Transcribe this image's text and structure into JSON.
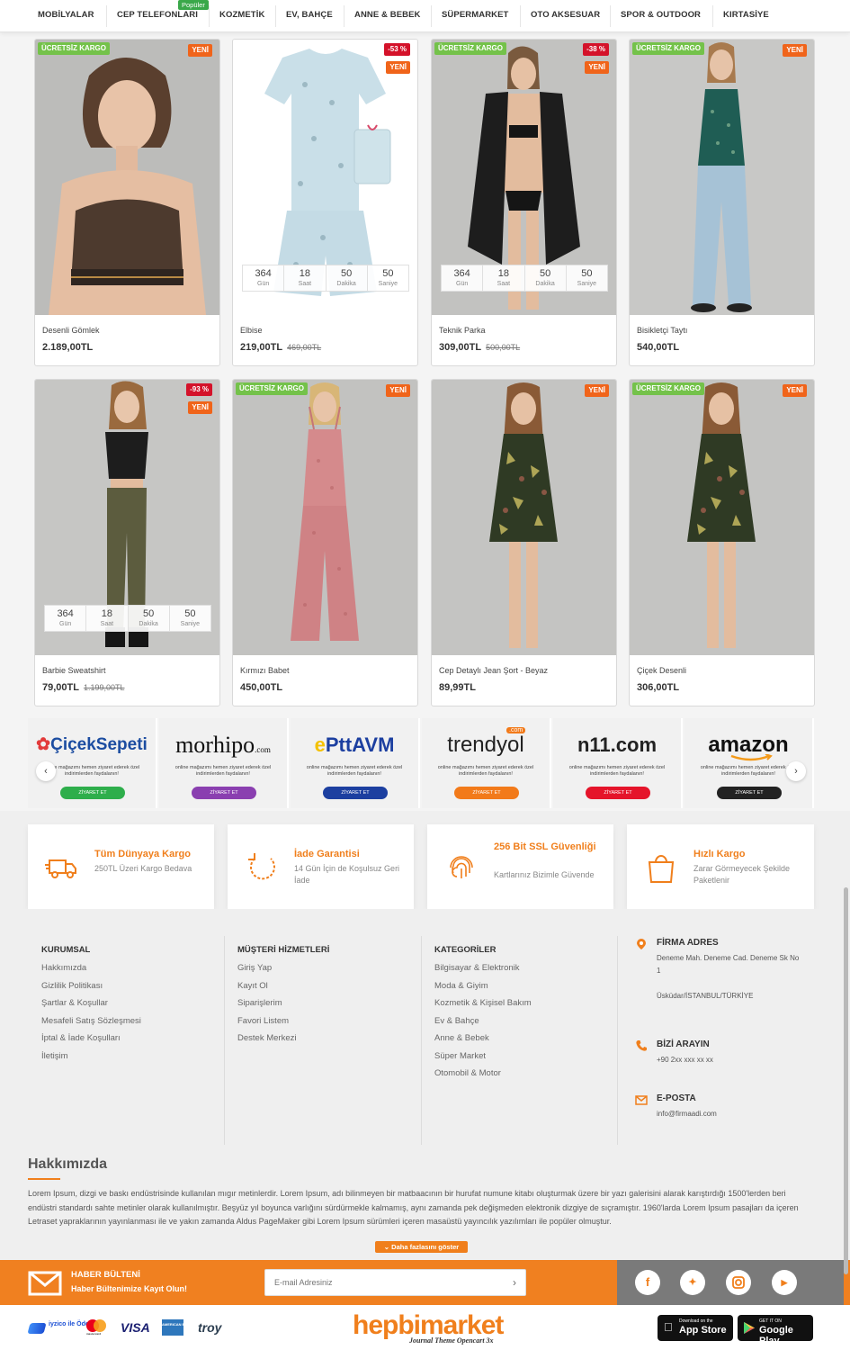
{
  "topnav": {
    "items": [
      "MOBİLYALAR",
      "CEP TELEFONLARI",
      "KOZMETİK",
      "EV, BAHÇE",
      "ANNE & BEBEK",
      "SÜPERMARKET",
      "OTO AKSESUAR",
      "SPOR & OUTDOOR",
      "KIRTASİYE"
    ],
    "popular_badge": "Popüler"
  },
  "labels": {
    "cargo": "ÜCRETSİZ KARGO",
    "new": "YENİ",
    "days": "Gün",
    "hours": "Saat",
    "minutes": "Dakika",
    "seconds": "Saniye"
  },
  "products": [
    {
      "name": "Desenli Gömlek",
      "price": "2.189,00TL",
      "old_price": "",
      "cargo": true,
      "new": true,
      "discount": "",
      "countdown": null
    },
    {
      "name": "Elbise",
      "price": "219,00TL",
      "old_price": "469,00TL",
      "cargo": false,
      "new": true,
      "discount": "-53 %",
      "countdown": [
        "364",
        "18",
        "50",
        "50"
      ]
    },
    {
      "name": "Teknik Parka",
      "price": "309,00TL",
      "old_price": "500,00TL",
      "cargo": true,
      "new": true,
      "discount": "-38 %",
      "countdown": [
        "364",
        "18",
        "50",
        "50"
      ]
    },
    {
      "name": "Bisikletçi Taytı",
      "price": "540,00TL",
      "old_price": "",
      "cargo": true,
      "new": true,
      "discount": "",
      "countdown": null
    },
    {
      "name": "Barbie Sweatshirt",
      "price": "79,00TL",
      "old_price": "1.199,00TL",
      "cargo": false,
      "new": true,
      "discount": "-93 %",
      "countdown": [
        "364",
        "18",
        "50",
        "50"
      ]
    },
    {
      "name": "Kırmızı Babet",
      "price": "450,00TL",
      "old_price": "",
      "cargo": true,
      "new": true,
      "discount": "",
      "countdown": null
    },
    {
      "name": "Cep Detaylı Jean Şort - Beyaz",
      "price": "89,99TL",
      "old_price": "",
      "cargo": false,
      "new": true,
      "discount": "",
      "countdown": null
    },
    {
      "name": "Çiçek Desenli",
      "price": "306,00TL",
      "old_price": "",
      "cargo": true,
      "new": true,
      "discount": "",
      "countdown": null
    }
  ],
  "brands": {
    "text": "online mağazımı hemen ziyaret ederek özel indirimlerden faydalanın!",
    "visit_label": "ZİYARET ET",
    "items": [
      {
        "name": "ÇiçekSepeti",
        "button_color": "#2eae4b"
      },
      {
        "name": "morhipo",
        "sub": ".com",
        "button_color": "#8a3fb0"
      },
      {
        "name": "PttAVM",
        "button_color": "#1c3fa0"
      },
      {
        "name": "trendyol",
        "badge": ".com",
        "button_color": "#f27a1a"
      },
      {
        "name": "n11.com",
        "button_color": "#e5142a"
      },
      {
        "name": "amazon",
        "button_color": "#222222"
      }
    ]
  },
  "features": [
    {
      "title": "Tüm Dünyaya Kargo",
      "subtitle": "250TL Üzeri Kargo Bedava",
      "icon": "truck-icon"
    },
    {
      "title": "İade Garantisi",
      "subtitle": "14 Gün İçin de Koşulsuz Geri İade",
      "icon": "return-icon"
    },
    {
      "title": "256 Bit SSL Güvenliği",
      "subtitle": "Kartlarınız Bizimle Güvende",
      "icon": "fingerprint-icon"
    },
    {
      "title": "Hızlı Kargo",
      "subtitle": "Zarar Görmeyecek Şekilde Paketlenir",
      "icon": "bag-icon"
    }
  ],
  "footer": {
    "kurumsal": {
      "title": "KURUMSAL",
      "links": [
        "Hakkımızda",
        "Gizlilik Politikası",
        "Şartlar & Koşullar",
        "Mesafeli Satış Sözleşmesi",
        "İptal & İade Koşulları",
        "İletişim"
      ]
    },
    "musteri": {
      "title": "MÜŞTERİ HİZMETLERİ",
      "links": [
        "Giriş Yap",
        "Kayıt Ol",
        "Siparişlerim",
        "Favori Listem",
        "Destek Merkezi"
      ]
    },
    "kategoriler": {
      "title": "KATEGORİLER",
      "links": [
        "Bilgisayar & Elektronik",
        "Moda & Giyim",
        "Kozmetik & Kişisel Bakım",
        "Ev & Bahçe",
        "Anne & Bebek",
        "Süper Market",
        "Otomobil & Motor"
      ]
    },
    "contact": {
      "address_title": "FİRMA ADRES",
      "address_line1": "Deneme Mah. Deneme Cad. Deneme Sk No 1",
      "address_line2": "Üsküdar/İSTANBUL/TÜRKİYE",
      "phone_title": "BİZİ ARAYIN",
      "phone": "+90 2xx xxx xx xx",
      "email_title": "E-POSTA",
      "email": "info@firmaadi.com"
    }
  },
  "about": {
    "title": "Hakkımızda",
    "text": "Lorem Ipsum, dizgi ve baskı endüstrisinde kullanılan mıgır metinlerdir. Lorem Ipsum, adı bilinmeyen bir matbaacının bir hurufat numune kitabı oluşturmak üzere bir yazı galerisini alarak karıştırdığı 1500'lerden beri endüstri standardı sahte metinler olarak kullanılmıştır. Beşyüz yıl boyunca varlığını sürdürmekle kalmamış, aynı zamanda pek değişmeden elektronik dizgiye de sıçramıştır. 1960'larda Lorem Ipsum pasajları da içeren Letraset yapraklarının yayınlanması ile ve yakın zamanda Aldus PageMaker gibi Lorem Ipsum sürümleri içeren masaüstü yayıncılık yazılımları ile popüler olmuştur.",
    "more_label": "Daha fazlasını göster"
  },
  "newsletter": {
    "title": "HABER BÜLTENİ",
    "subtitle": "Haber Bültenimize Kayıt Olun!",
    "placeholder": "E-mail Adresiniz"
  },
  "bottom": {
    "payments": [
      "iyzico ile Öde",
      "mastercard",
      "VISA",
      "AMERICAN EXPRESS",
      "troy"
    ],
    "logo": "hepbimarket",
    "logo_tag": "Journal Theme Opencart 3x",
    "appstore_small": "Download on the",
    "appstore": "App Store",
    "googleplay_small": "GET IT ON",
    "googleplay": "Google Play"
  },
  "colors": {
    "accent": "#f07f1c",
    "cargo": "#74c24a",
    "new": "#f0641a",
    "discount": "#d4122a"
  }
}
